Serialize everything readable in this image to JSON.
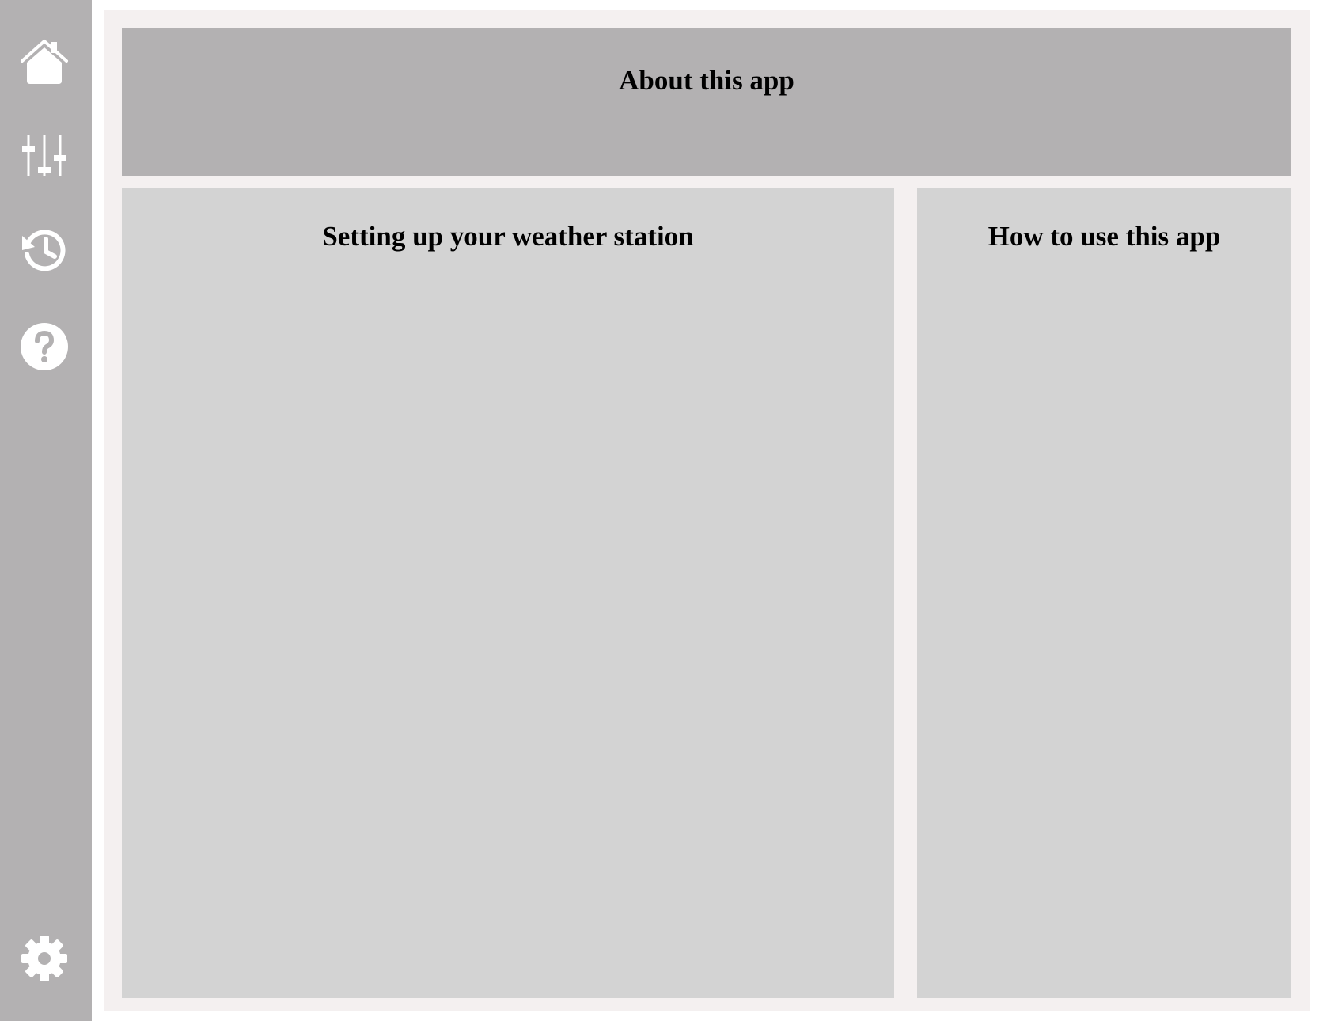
{
  "colors": {
    "sidebar_bg": "#b3b1b2",
    "main_bg": "#f4f0f0",
    "header_panel_bg": "#b3b1b2",
    "content_panel_bg": "#d3d3d3",
    "icon_color": "#ffffff"
  },
  "sidebar": {
    "items": [
      {
        "icon": "home-icon"
      },
      {
        "icon": "sliders-icon"
      },
      {
        "icon": "history-icon"
      },
      {
        "icon": "help-icon"
      }
    ],
    "footer_icon": "gear-icon"
  },
  "main": {
    "about_title": "About this app",
    "setup_title": "Setting up your weather station",
    "howto_title": "How to use this app"
  }
}
